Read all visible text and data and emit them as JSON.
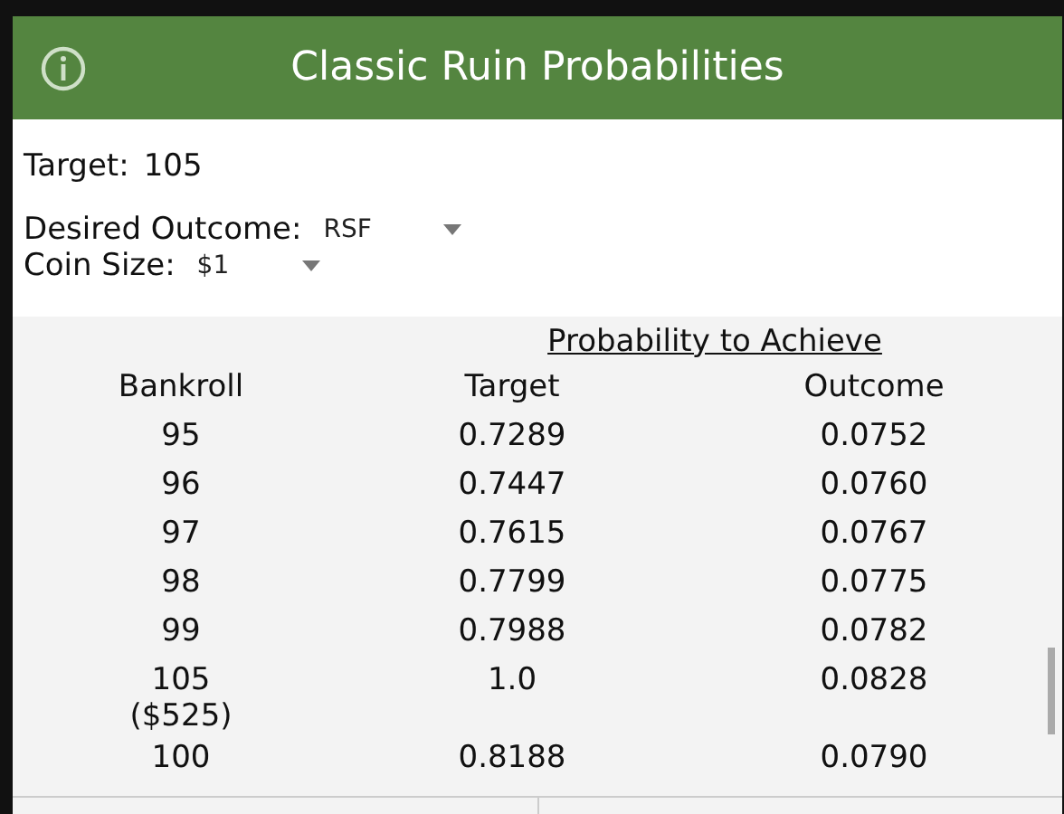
{
  "window": {
    "title": "Classic Ruin Probabilities"
  },
  "target": {
    "label": "Target:",
    "value": "105"
  },
  "desired_outcome": {
    "label": "Desired Outcome:",
    "value": "RSF"
  },
  "coin_size": {
    "label": "Coin Size:",
    "value": "$1"
  },
  "table": {
    "group_heading": "Probability to Achieve",
    "columns": [
      "Bankroll",
      "Target",
      "Outcome"
    ],
    "rows": [
      {
        "bankroll": "95",
        "target": "0.7289",
        "outcome": "0.0752"
      },
      {
        "bankroll": "96",
        "target": "0.7447",
        "outcome": "0.0760"
      },
      {
        "bankroll": "97",
        "target": "0.7615",
        "outcome": "0.0767"
      },
      {
        "bankroll": "98",
        "target": "0.7799",
        "outcome": "0.0775"
      },
      {
        "bankroll": "99",
        "target": "0.7988",
        "outcome": "0.0782"
      },
      {
        "bankroll": "105",
        "note": "($525)",
        "target": "1.0",
        "outcome": "0.0828"
      },
      {
        "bankroll": "100",
        "target": "0.8188",
        "outcome": "0.0790"
      }
    ]
  }
}
